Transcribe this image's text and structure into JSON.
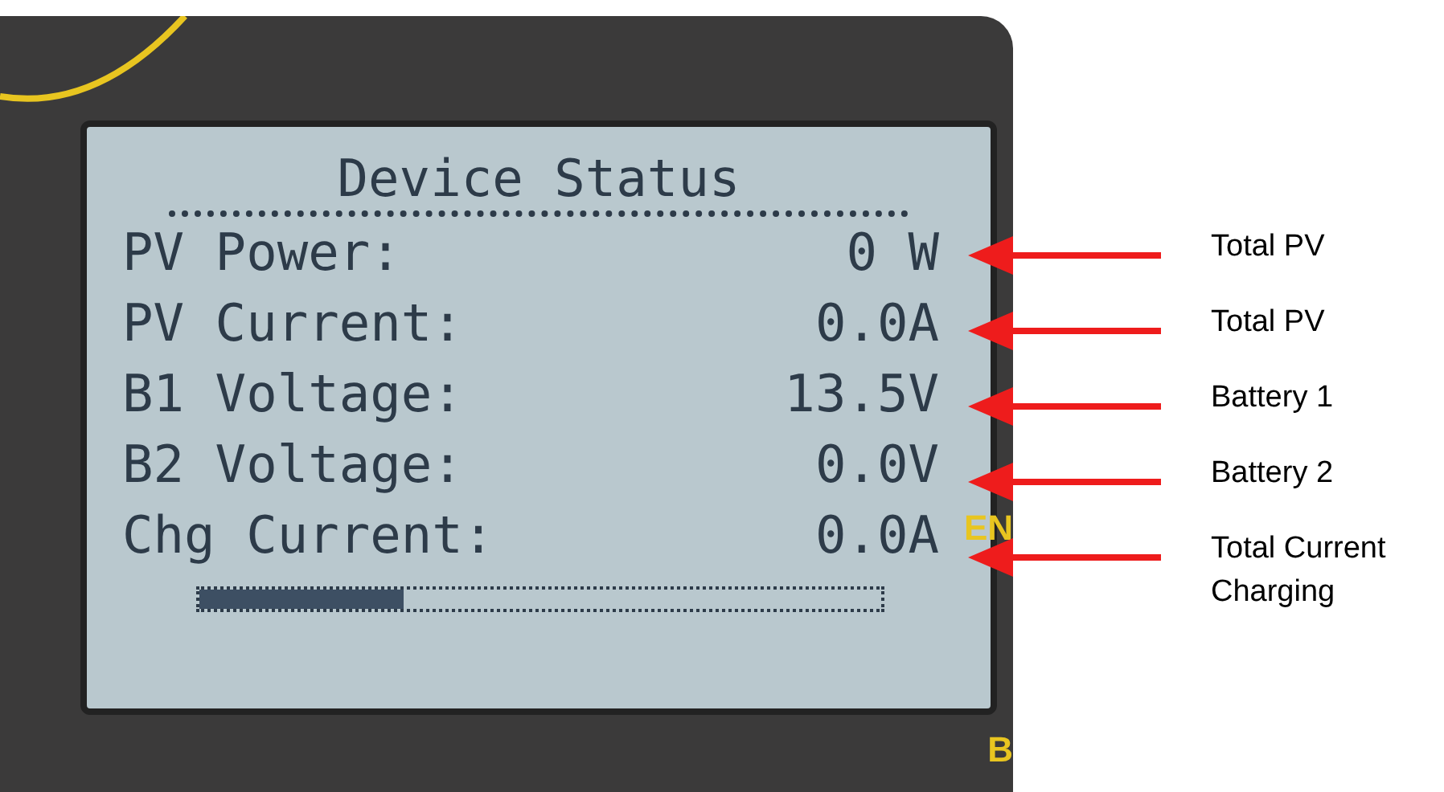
{
  "display": {
    "title": "Device Status",
    "rows": [
      {
        "label": "PV Power:",
        "value": "0 W"
      },
      {
        "label": "PV Current:",
        "value": "0.0A"
      },
      {
        "label": "B1 Voltage:",
        "value": "13.5V"
      },
      {
        "label": "B2 Voltage:",
        "value": "0.0V"
      },
      {
        "label": "Chg Current:",
        "value": "0.0A"
      }
    ],
    "progress": {
      "level": 0.3
    }
  },
  "bezel_labels": [
    "EN",
    "B"
  ],
  "annotations": [
    {
      "text": "Total PV"
    },
    {
      "text": "Total PV"
    },
    {
      "text": "Battery 1"
    },
    {
      "text": "Battery 2"
    },
    {
      "text": "Total Current Charging"
    }
  ]
}
